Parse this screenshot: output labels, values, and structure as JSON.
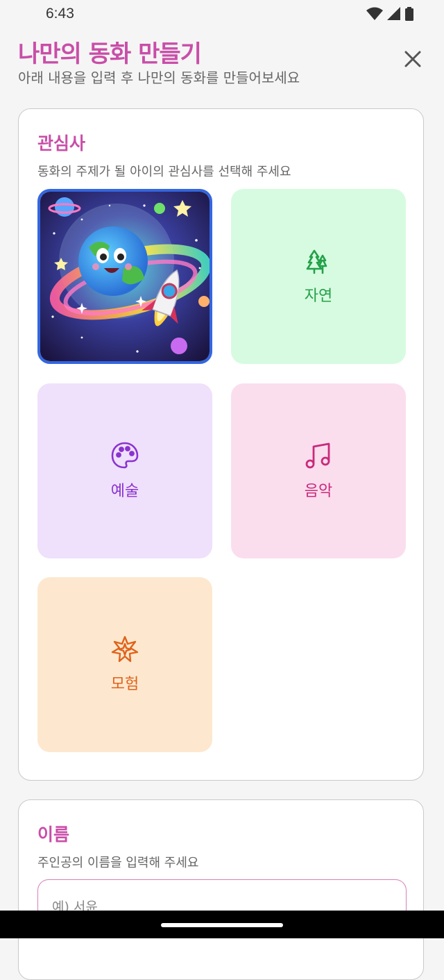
{
  "status_bar": {
    "time": "6:43",
    "icons": [
      "wifi-icon",
      "signal-icon",
      "battery-icon"
    ]
  },
  "header": {
    "title": "나만의 동화 만들기",
    "subtitle": "아래 내용을 입력 후 나만의 동화를 만들어보세요",
    "close_icon": "close-icon"
  },
  "interest": {
    "title": "관심사",
    "description": "동화의 주제가 될 아이의 관심사를 선택해 주세요",
    "selected": "space",
    "tiles": [
      {
        "id": "space",
        "image": "space-illustration",
        "selected": true
      },
      {
        "id": "nature",
        "label": "자연",
        "icon": "tree-icon",
        "color": "#24a14a",
        "bg": "#d7fbe0"
      },
      {
        "id": "art",
        "label": "예술",
        "icon": "palette-icon",
        "color": "#8a33cf",
        "bg": "#efe0fb"
      },
      {
        "id": "music",
        "label": "음악",
        "icon": "music-note-icon",
        "color": "#c92a7c",
        "bg": "#fbdeee"
      },
      {
        "id": "adventure",
        "label": "모험",
        "icon": "star-burst-icon",
        "color": "#e0621a",
        "bg": "#fde8cf"
      }
    ]
  },
  "name_section": {
    "title": "이름",
    "description": "주인공의 이름을 입력해 주세요",
    "placeholder": "예) 서윤",
    "value": ""
  },
  "colors": {
    "accent": "#c94ea8",
    "selected_border": "#3366e0",
    "input_border": "#d77fb8"
  }
}
